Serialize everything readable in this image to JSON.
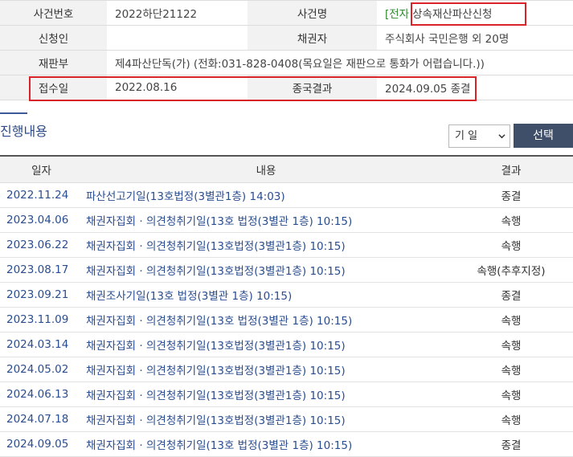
{
  "case_info": {
    "case_number_label": "사건번호",
    "case_number": "2022하단21122",
    "case_name_label": "사건명",
    "ecase_tag": "[전자",
    "case_name": "상속재산파산신청",
    "applicant_label": "신청인",
    "applicant": "",
    "creditor_label": "채권자",
    "creditor": "주식회사 국민은행 외 20명",
    "court_label": "재판부",
    "court": "제4파산단독(가) (전화:031-828-0408(목요일은 재판으로 통화가 어렵습니다.))",
    "received_label": "접수일",
    "received_date": "2022.08.16",
    "final_result_label": "종국결과",
    "final_result": "2024.09.05 종결"
  },
  "progress": {
    "title": "진행내용",
    "filter_selected": "기 일",
    "select_button": "선택",
    "columns": [
      "일자",
      "내용",
      "결과"
    ],
    "rows": [
      {
        "date": "2022.11.24",
        "content": "파산선고기일(13호법정(3별관1층) 14:03)",
        "result": "종결"
      },
      {
        "date": "2023.04.06",
        "content": "채권자집회 · 의견청취기일(13호 법정(3별관 1층) 10:15)",
        "result": "속행"
      },
      {
        "date": "2023.06.22",
        "content": "채권자집회 · 의견청취기일(13호법정(3별관1층) 10:15)",
        "result": "속행"
      },
      {
        "date": "2023.08.17",
        "content": "채권자집회 · 의견청취기일(13호법정(3별관1층) 10:15)",
        "result": "속행(추후지정)"
      },
      {
        "date": "2023.09.21",
        "content": "채권조사기일(13호 법정(3별관 1층) 10:15)",
        "result": "종결"
      },
      {
        "date": "2023.11.09",
        "content": "채권자집회 · 의견청취기일(13호 법정(3별관 1층) 10:15)",
        "result": "속행"
      },
      {
        "date": "2024.03.14",
        "content": "채권자집회 · 의견청취기일(13호법정(3별관1층) 10:15)",
        "result": "속행"
      },
      {
        "date": "2024.05.02",
        "content": "채권자집회 · 의견청취기일(13호법정(3별관1층) 10:15)",
        "result": "속행"
      },
      {
        "date": "2024.06.13",
        "content": "채권자집회 · 의견청취기일(13호법정(3별관1층) 10:15)",
        "result": "속행"
      },
      {
        "date": "2024.07.18",
        "content": "채권자집회 · 의견청취기일(13호법정(3별관1층) 10:15)",
        "result": "속행"
      },
      {
        "date": "2024.09.05",
        "content": "채권자집회 · 의견청취기일(13호 법정(3별관 1층) 10:15)",
        "result": "종결"
      }
    ]
  },
  "colors": {
    "highlight": "#d8232a",
    "link": "#2a4d8f",
    "button": "#3f4e69",
    "label_bg": "#f2f2f2"
  }
}
